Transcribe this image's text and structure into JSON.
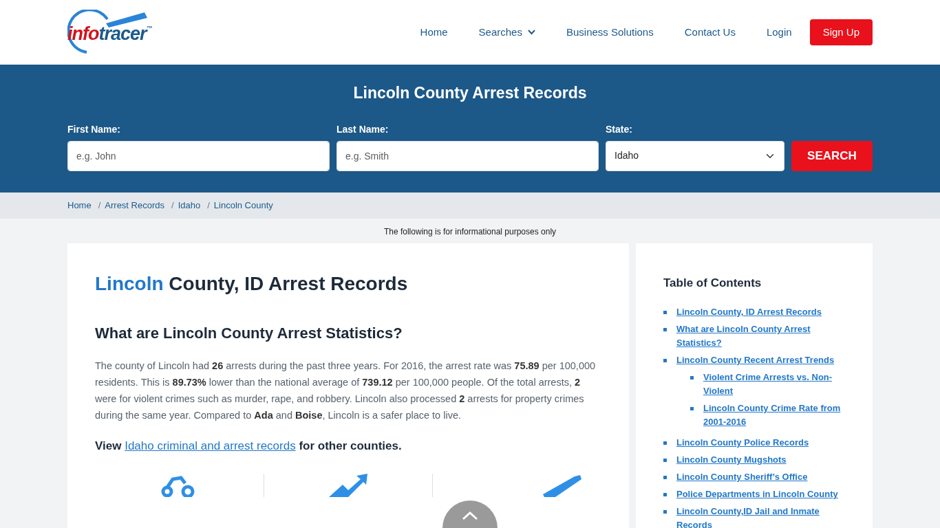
{
  "logo": {
    "first": "info",
    "second": "tracer",
    "mark": "™"
  },
  "nav": [
    {
      "label": "Home",
      "kind": "link"
    },
    {
      "label": "Searches",
      "kind": "dropdown"
    },
    {
      "label": "Business Solutions",
      "kind": "link"
    },
    {
      "label": "Contact Us",
      "kind": "link"
    },
    {
      "label": "Login",
      "kind": "link"
    },
    {
      "label": "Sign Up",
      "kind": "button"
    }
  ],
  "hero": {
    "title": "Lincoln County Arrest Records",
    "fields": [
      {
        "label": "First Name:",
        "kind": "text",
        "placeholder": "e.g. John"
      },
      {
        "label": "Last Name:",
        "kind": "text",
        "placeholder": "e.g. Smith"
      },
      {
        "label": "State:",
        "kind": "select",
        "value": "Idaho"
      }
    ],
    "button": "SEARCH"
  },
  "breadcrumb": {
    "separator": "/",
    "items": [
      "Home",
      "Arrest Records",
      "Idaho",
      "Lincoln County"
    ]
  },
  "notice": "The following is for informational purposes only",
  "article": {
    "title_highlight": "Lincoln",
    "title_rest": "County, ID Arrest Records",
    "heading": "What are Lincoln County Arrest Statistics?",
    "paragraph": "The county of Lincoln had **26** arrests during the past three years. For 2016, the arrest rate was **75.89** per 100,000 residents. This is **89.73%** lower than the national average of **739.12** per 100,000 people. Of the total arrests, **2** were for violent crimes such as murder, rape, and robbery. Lincoln also processed **2** arrests for property crimes during the same year. Compared to **Ada** and **Boise**, Lincoln is a safer place to live.",
    "view_before": "View",
    "view_link": "Idaho criminal and arrest records",
    "view_after": "for other counties."
  },
  "toc": {
    "title": "Table of Contents",
    "items": [
      {
        "label": "Lincoln County, ID Arrest Records"
      },
      {
        "label": "What are Lincoln County Arrest Statistics?"
      },
      {
        "label": "Lincoln County Recent Arrest Trends",
        "children": [
          {
            "label": "Violent Crime Arrests vs. Non-Violent"
          },
          {
            "label": "Lincoln County Crime Rate from 2001-2016"
          }
        ]
      },
      {
        "label": "Lincoln County Police Records"
      },
      {
        "label": "Lincoln County Mugshots"
      },
      {
        "label": "Lincoln County Sheriff’s Office"
      },
      {
        "label": "Police Departments in Lincoln County"
      },
      {
        "label": "Lincoln County,ID Jail and Inmate Records"
      }
    ]
  }
}
